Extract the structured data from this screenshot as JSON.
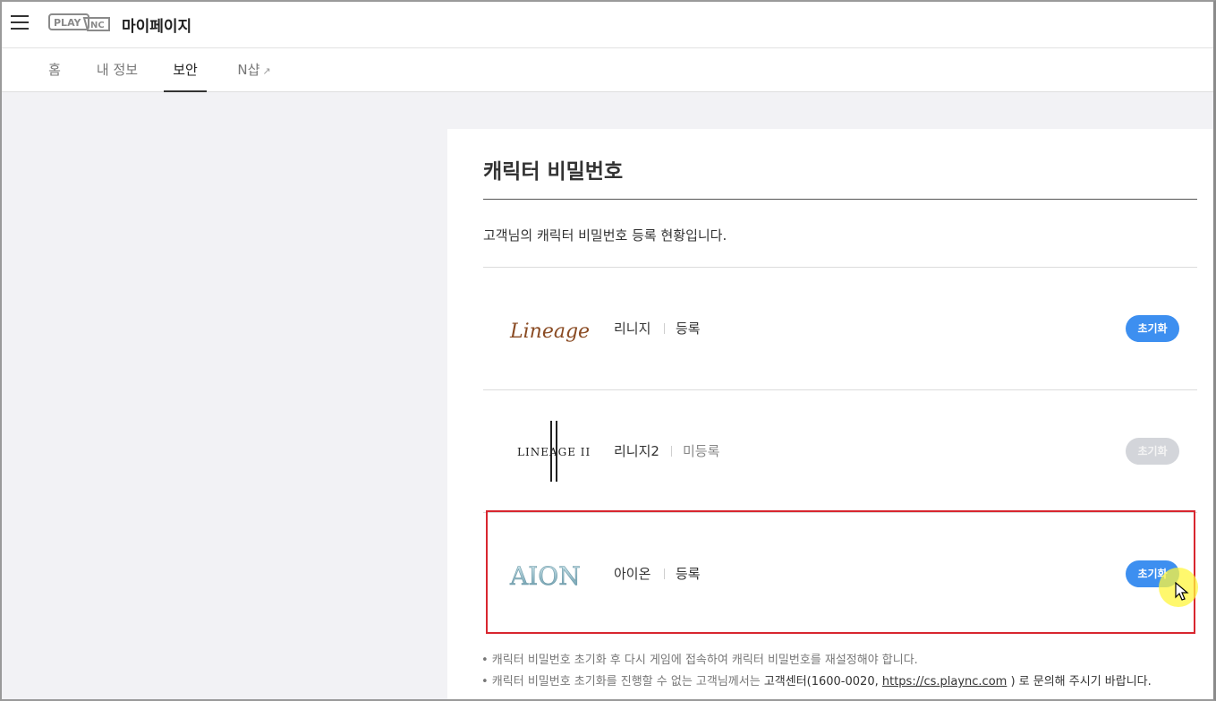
{
  "header": {
    "logo_text": "PLAY NC",
    "title": "마이페이지",
    "menu_icon": "hamburger-menu-icon"
  },
  "nav": {
    "tabs": [
      {
        "label": "홈",
        "active": false
      },
      {
        "label": "내 정보",
        "active": false
      },
      {
        "label": "보안",
        "active": true
      },
      {
        "label": "N샵",
        "active": false,
        "external": true
      }
    ],
    "external_icon": "↗"
  },
  "section": {
    "title": "캐릭터 비밀번호",
    "description": "고객님의 캐릭터 비밀번호 등록 현황입니다."
  },
  "games": [
    {
      "logo": "Lineage",
      "name": "리니지",
      "status": "등록",
      "registered": true,
      "button": "초기화"
    },
    {
      "logo": "LINEAGE II",
      "name": "리니지2",
      "status": "미등록",
      "registered": false,
      "button": "초기화"
    },
    {
      "logo": "AION",
      "name": "아이온",
      "status": "등록",
      "registered": true,
      "button": "초기화"
    }
  ],
  "notes": {
    "line1": "• 캐릭터 비밀번호 초기화 후 다시 게임에 접속하여 캐릭터 비밀번호를 재설정해야 합니다.",
    "line2_prefix": "• 캐릭터 비밀번호 초기화를 진행할 수 없는 고객님께서는 ",
    "line2_center": "고객센터",
    "line2_phone": "(1600-0020, ",
    "line2_link": "https://cs.plaync.com",
    "line2_suffix": " ) 로 문의해 주시기 바랍니다."
  },
  "colors": {
    "accent": "#3d8ff0",
    "disabled": "#d3d5da",
    "highlight": "#d8262f",
    "background": "#f2f2f5"
  }
}
